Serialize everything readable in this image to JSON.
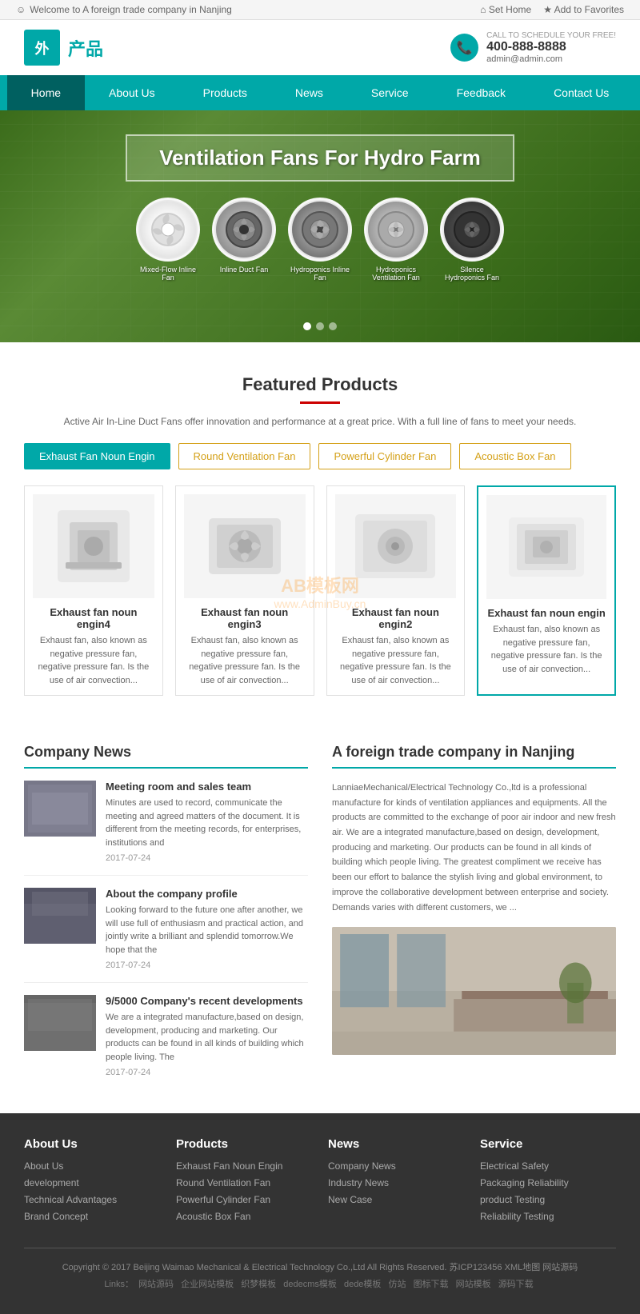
{
  "topbar": {
    "welcome": "Welcome to A foreign trade company in Nanjing",
    "set_home": "Set Home",
    "add_favorites": "Add to Favorites"
  },
  "header": {
    "logo_char": "外",
    "logo_text": "产品",
    "call_label": "CALL TO SCHEDULE YOUR FREE!",
    "phone": "400-888-8888",
    "email": "admin@admin.com"
  },
  "nav": {
    "items": [
      {
        "label": "Home",
        "active": true
      },
      {
        "label": "About Us",
        "active": false
      },
      {
        "label": "Products",
        "active": false
      },
      {
        "label": "News",
        "active": false
      },
      {
        "label": "Service",
        "active": false
      },
      {
        "label": "Feedback",
        "active": false
      },
      {
        "label": "Contact Us",
        "active": false
      }
    ]
  },
  "hero": {
    "title": "Ventilation Fans For Hydro Farm",
    "products": [
      {
        "label": "Mixed-Flow Inline Fan"
      },
      {
        "label": "Inline Duct Fan"
      },
      {
        "label": "Hydroponics Inline Fan"
      },
      {
        "label": "Hydroponics Ventilation Fan"
      },
      {
        "label": "Silence Hydroponics Fan"
      }
    ]
  },
  "featured_products": {
    "title": "Featured Products",
    "description": "Active Air In-Line Duct Fans offer innovation and performance at a great price. With a full line of fans to meet your needs.",
    "tabs": [
      {
        "label": "Exhaust Fan Noun Engin",
        "active": true
      },
      {
        "label": "Round Ventilation Fan",
        "active": false
      },
      {
        "label": "Powerful Cylinder Fan",
        "active": false
      },
      {
        "label": "Acoustic Box Fan",
        "active": false
      }
    ],
    "products": [
      {
        "name": "Exhaust fan noun engin4",
        "desc": "Exhaust fan, also known as negative pressure fan, negative pressure fan. Is the use of air convection...",
        "highlighted": false
      },
      {
        "name": "Exhaust fan noun engin3",
        "desc": "Exhaust fan, also known as negative pressure fan, negative pressure fan. Is the use of air convection...",
        "highlighted": false
      },
      {
        "name": "Exhaust fan noun engin2",
        "desc": "Exhaust fan, also known as negative pressure fan, negative pressure fan. Is the use of air convection...",
        "highlighted": false
      },
      {
        "name": "Exhaust fan noun engin",
        "desc": "Exhaust fan, also known as negative pressure fan, negative pressure fan. Is the use of air convection...",
        "highlighted": true
      }
    ]
  },
  "company_news": {
    "title": "Company News",
    "items": [
      {
        "title": "Meeting room and sales team",
        "desc": "Minutes are used to record, communicate the meeting and agreed matters of the document. It is different from the meeting records, for enterprises, institutions and",
        "date": "2017-07-24"
      },
      {
        "title": "About the company profile",
        "desc": "Looking forward to the future one after another, we will use full of enthusiasm and practical action, and jointly write a brilliant and splendid tomorrow.We hope that the",
        "date": "2017-07-24"
      },
      {
        "title": "9/5000 Company's recent developments",
        "desc": "We are a integrated manufacture,based on design, development, producing and marketing. Our products can be found in all kinds of building which people living. The",
        "date": "2017-07-24"
      }
    ]
  },
  "about": {
    "title": "A foreign trade company in Nanjing",
    "desc": "LanniaeMechanical/Electrical Technology Co.,ltd is a professional manufacture for kinds of ventilation appliances and equipments. All the products are committed to the exchange of poor air indoor and new fresh air. We are a integrated manufacture,based on design, development, producing and marketing. Our products can be found in all kinds of building which people living. The greatest compliment we receive has been our effort to balance the stylish living and global environment, to improve the collaborative development between enterprise and society. Demands varies with different customers, we ..."
  },
  "footer": {
    "columns": [
      {
        "title": "About Us",
        "links": [
          "About Us",
          "development",
          "Technical Advantages",
          "Brand Concept"
        ]
      },
      {
        "title": "Products",
        "links": [
          "Exhaust Fan Noun Engin",
          "Round Ventilation Fan",
          "Powerful Cylinder Fan",
          "Acoustic Box Fan"
        ]
      },
      {
        "title": "News",
        "links": [
          "Company News",
          "Industry News",
          "New Case"
        ]
      },
      {
        "title": "Service",
        "links": [
          "Electrical Safety",
          "Packaging Reliability",
          "product Testing",
          "Reliability Testing"
        ]
      }
    ],
    "copyright": "Copyright © 2017 Beijing Waimao Mechanical & Electrical Technology Co.,Ltd All Rights Reserved. 苏ICP123456 XML地图 网站源码",
    "links": "Links： 网站源码  企业网站模板  织梦模板  dedecms模板  dede模板  仿站  图标下载  网站模板  源码下载"
  },
  "watermark": {
    "line1": "AB模板网",
    "line2": "www.AdminBuy.cn"
  }
}
